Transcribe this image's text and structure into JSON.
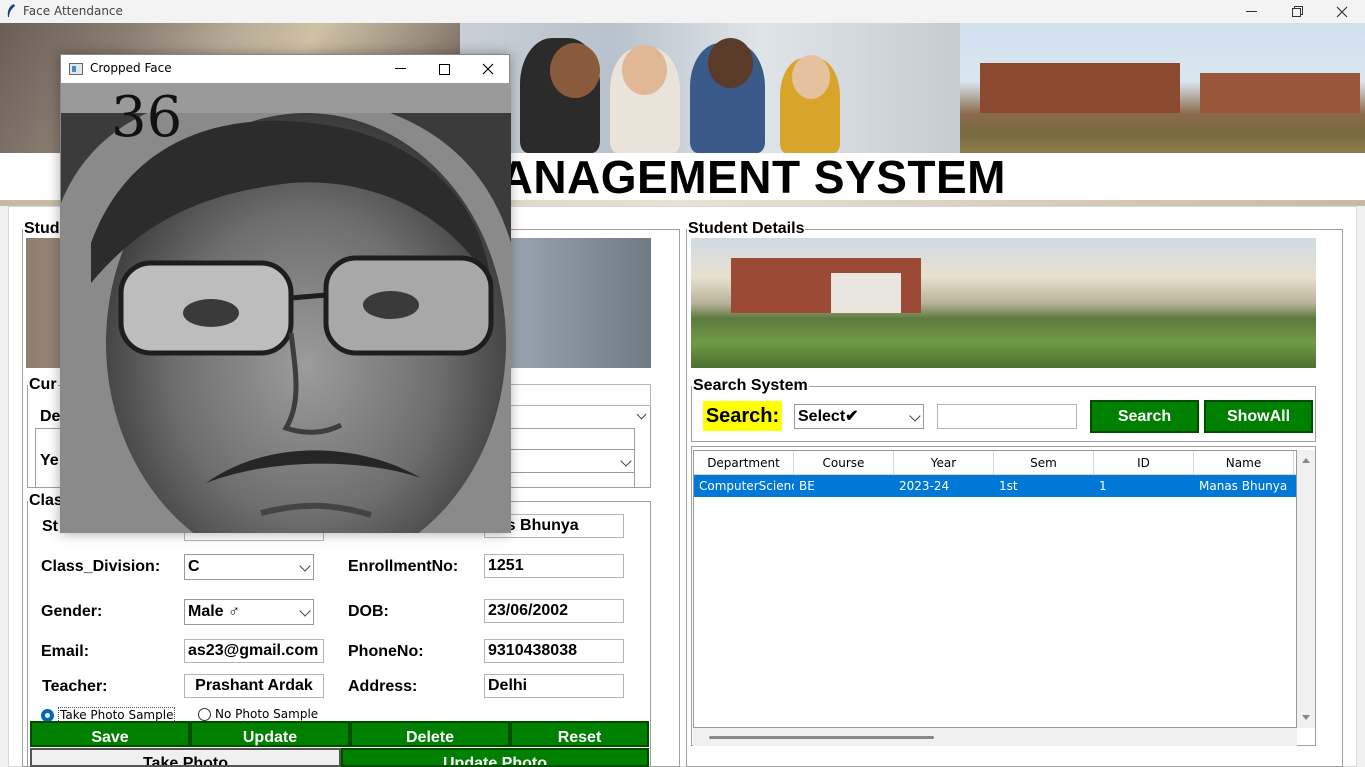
{
  "app": {
    "title": "Face Attendance",
    "heading": "ENT MANAGEMENT SYSTEM"
  },
  "face_window": {
    "title": "Cropped Face",
    "confidence_label": "36"
  },
  "left_panel": {
    "legend": "Stud",
    "current_course_legend": "Cur",
    "dept_label": "De",
    "year_label": "Ye",
    "class_legend": "Clas",
    "student_label": "St",
    "name_value": "nas Bhunya",
    "class_division_label": "Class_Division:",
    "class_division_value": "C",
    "enrollment_label": "EnrollmentNo:",
    "enrollment_value": "1251",
    "gender_label": "Gender:",
    "gender_value": "Male ♂",
    "dob_label": "DOB:",
    "dob_value": "23/06/2002",
    "email_label": "Email:",
    "email_value": "as23@gmail.com",
    "phone_label": "PhoneNo:",
    "phone_value": "9310438038",
    "teacher_label": "Teacher:",
    "teacher_value": "Prashant Ardak",
    "address_label": "Address:",
    "address_value": "Delhi",
    "radio_take": "Take Photo Sample",
    "radio_no": "No Photo Sample",
    "buttons": {
      "save": "Save",
      "update": "Update",
      "delete": "Delete",
      "reset": "Reset"
    },
    "take_photo": "Take  Photo",
    "update_photo": "Update  Photo"
  },
  "right_panel": {
    "legend": "Student Details",
    "search_legend": "Search System",
    "search_label": "Search:",
    "search_by": "Select✔",
    "search_value": "",
    "search_button": "Search",
    "showall_button": "ShowAll",
    "table": {
      "columns": [
        "Department",
        "Course",
        "Year",
        "Sem",
        "ID",
        "Name"
      ],
      "rows": [
        [
          "ComputerScience",
          "BE",
          "2023-24",
          "1st",
          "1",
          "Manas Bhunya"
        ]
      ]
    }
  },
  "colors": {
    "green_button": "#008000",
    "search_highlight": "#ffff00",
    "selection": "#0078d7"
  }
}
